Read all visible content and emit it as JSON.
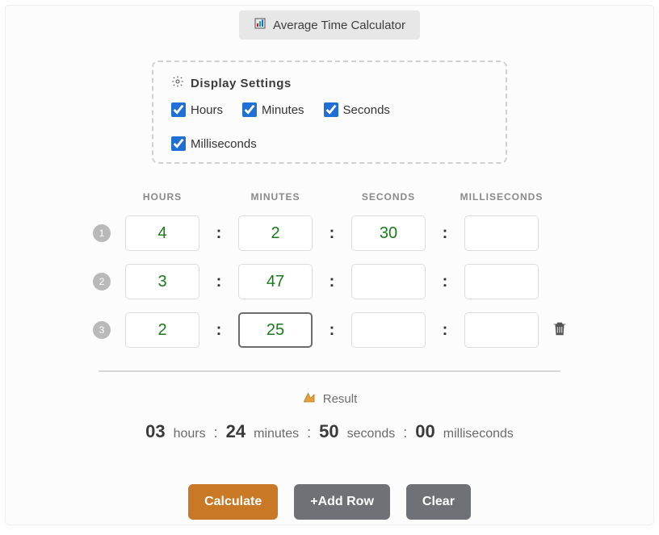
{
  "title": "Average Time Calculator",
  "settings": {
    "heading": "Display Settings",
    "options": {
      "hours": {
        "label": "Hours",
        "checked": true
      },
      "minutes": {
        "label": "Minutes",
        "checked": true
      },
      "seconds": {
        "label": "Seconds",
        "checked": true
      },
      "milliseconds": {
        "label": "Milliseconds",
        "checked": true
      }
    }
  },
  "headers": {
    "hours": "HOURS",
    "minutes": "MINUTES",
    "seconds": "SECONDS",
    "milliseconds": "MILLISECONDS"
  },
  "rows": [
    {
      "n": "1",
      "h": "4",
      "m": "2",
      "s": "30",
      "ms": ""
    },
    {
      "n": "2",
      "h": "3",
      "m": "47",
      "s": "",
      "ms": ""
    },
    {
      "n": "3",
      "h": "2",
      "m": "25",
      "s": "",
      "ms": ""
    }
  ],
  "result": {
    "label": "Result",
    "hours": {
      "value": "03",
      "unit": "hours"
    },
    "minutes": {
      "value": "24",
      "unit": "minutes"
    },
    "seconds": {
      "value": "50",
      "unit": "seconds"
    },
    "milliseconds": {
      "value": "00",
      "unit": "milliseconds"
    }
  },
  "buttons": {
    "calculate": "Calculate",
    "add_row": "+Add Row",
    "clear": "Clear"
  }
}
